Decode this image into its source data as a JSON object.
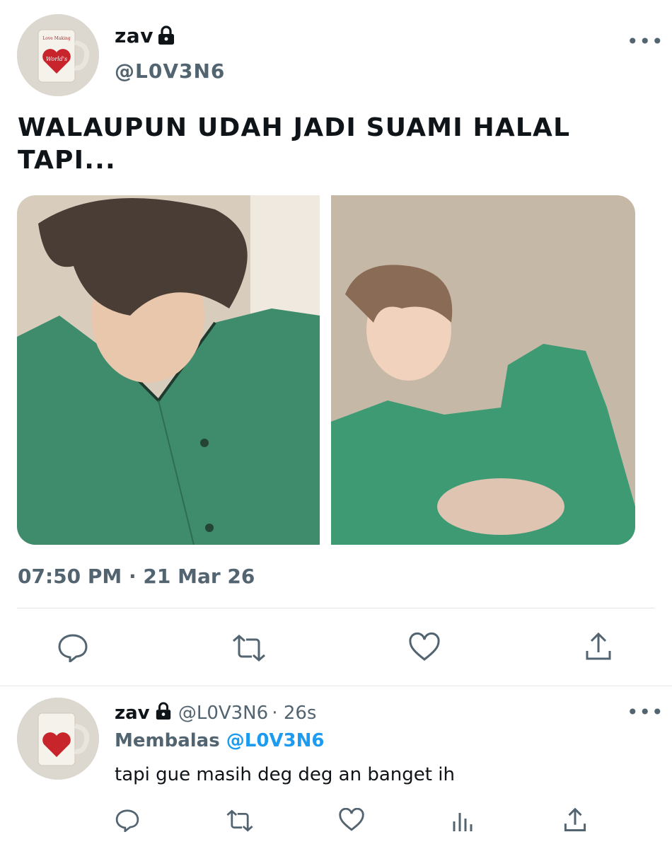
{
  "tweet": {
    "display_name": "zav",
    "handle": "@L0V3N6",
    "text_line1": "WALAUPUN UDAH JADI SUAMI HALAL",
    "text_line2": "TAPI...",
    "time": "07:50 PM",
    "date": "21 Mar 26",
    "more_label": "•••",
    "icons": {
      "locked": "lock-icon",
      "reply": "reply-icon",
      "retweet": "retweet-icon",
      "like": "heart-icon",
      "share": "share-icon",
      "avatar": "mug-avatar"
    },
    "media": [
      {
        "description": "photo",
        "dominant_color": "#3f8b6a"
      },
      {
        "description": "photo",
        "dominant_color": "#3d9a73"
      }
    ]
  },
  "reply": {
    "display_name": "zav",
    "handle": "@L0V3N6",
    "age": "26s",
    "replying_prefix": "Membalas",
    "replying_mention": "@L0V3N6",
    "text": "tapi gue masih deg deg an banget ih",
    "more_label": "•••",
    "icons": {
      "reply": "reply-icon",
      "retweet": "retweet-icon",
      "like": "heart-icon",
      "views": "views-icon",
      "share": "share-icon"
    }
  },
  "colors": {
    "text": "#0f1419",
    "secondary": "#536471",
    "link": "#1d9bf0",
    "divider": "#e3e6e8"
  }
}
